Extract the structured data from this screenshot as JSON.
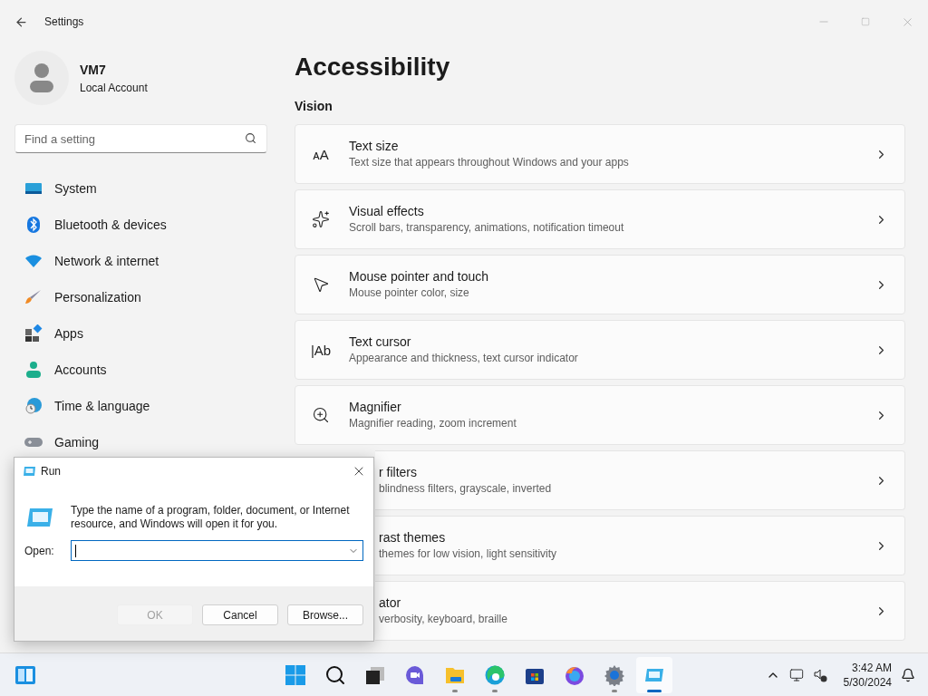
{
  "window": {
    "title": "Settings"
  },
  "account": {
    "name": "VM7",
    "type": "Local Account"
  },
  "search": {
    "placeholder": "Find a setting"
  },
  "nav": [
    {
      "label": "System"
    },
    {
      "label": "Bluetooth & devices"
    },
    {
      "label": "Network & internet"
    },
    {
      "label": "Personalization"
    },
    {
      "label": "Apps"
    },
    {
      "label": "Accounts"
    },
    {
      "label": "Time & language"
    },
    {
      "label": "Gaming"
    }
  ],
  "page": {
    "title": "Accessibility",
    "section": "Vision"
  },
  "cards": [
    {
      "glyph": "ᴀA",
      "title": "Text size",
      "subtitle": "Text size that appears throughout Windows and your apps",
      "covered": false
    },
    {
      "title": "Visual effects",
      "subtitle": "Scroll bars, transparency, animations, notification timeout",
      "covered": false
    },
    {
      "title": "Mouse pointer and touch",
      "subtitle": "Mouse pointer color, size",
      "covered": false
    },
    {
      "glyph": "|Ab",
      "title": "Text cursor",
      "subtitle": "Appearance and thickness, text cursor indicator",
      "covered": false
    },
    {
      "title": "Magnifier",
      "subtitle": "Magnifier reading, zoom increment",
      "covered": false
    },
    {
      "title": "r filters",
      "subtitle": "blindness filters, grayscale, inverted",
      "covered": true
    },
    {
      "title": "rast themes",
      "subtitle": "themes for low vision, light sensitivity",
      "covered": true
    },
    {
      "title": "ator",
      "subtitle": "verbosity, keyboard, braille",
      "covered": true
    }
  ],
  "run_dialog": {
    "title": "Run",
    "message": "Type the name of a program, folder, document, or Internet resource, and Windows will open it for you.",
    "open_label": "Open:",
    "buttons": [
      {
        "label": "OK",
        "disabled": true
      },
      {
        "label": "Cancel",
        "disabled": false
      },
      {
        "label": "Browse...",
        "disabled": false
      }
    ]
  },
  "taskbar": {
    "apps": [
      {
        "running": false,
        "active": false
      },
      {
        "running": false,
        "active": false
      },
      {
        "running": false,
        "active": false
      },
      {
        "running": false,
        "active": false
      },
      {
        "running": true,
        "active": false
      },
      {
        "running": true,
        "active": false
      },
      {
        "running": false,
        "active": false
      },
      {
        "running": false,
        "active": false
      },
      {
        "running": true,
        "active": false
      },
      {
        "running": true,
        "active": true
      }
    ],
    "time": "3:42 AM",
    "date": "5/30/2024"
  }
}
